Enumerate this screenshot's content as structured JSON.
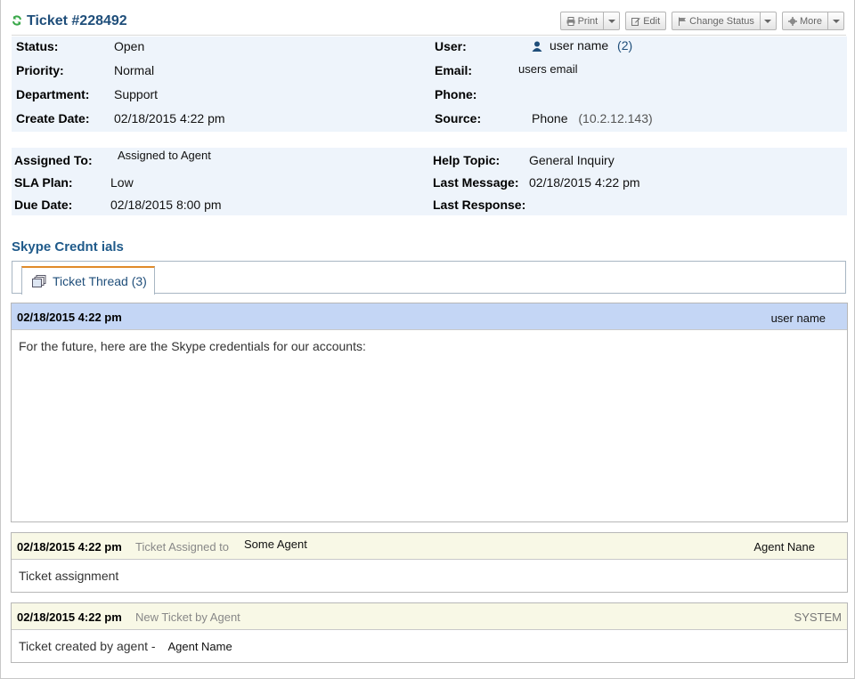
{
  "header": {
    "title": "Ticket #228492",
    "toolbar": {
      "print": "Print",
      "edit": "Edit",
      "change_status": "Change Status",
      "more": "More"
    }
  },
  "info1": {
    "status_label": "Status:",
    "status": "Open",
    "priority_label": "Priority:",
    "priority": "Normal",
    "department_label": "Department:",
    "department": "Support",
    "create_date_label": "Create Date:",
    "create_date": "02/18/2015 4:22 pm",
    "user_label": "User:",
    "user": "user name",
    "user_count": "(2)",
    "email_label": "Email:",
    "email": "users email",
    "phone_label": "Phone:",
    "phone": "",
    "source_label": "Source:",
    "source": "Phone",
    "source_ip": "(10.2.12.143)"
  },
  "info2": {
    "assigned_label": "Assigned To:",
    "assigned": "Assigned to Agent",
    "sla_label": "SLA Plan:",
    "sla": "Low",
    "due_label": "Due Date:",
    "due": "02/18/2015 8:00 pm",
    "help_label": "Help Topic:",
    "help": "General Inquiry",
    "last_msg_label": "Last Message:",
    "last_msg": "02/18/2015 4:22 pm",
    "last_resp_label": "Last Response:",
    "last_resp": ""
  },
  "section_title": "Skype Crednt ials",
  "tabs": [
    {
      "label": "Ticket Thread (3)"
    }
  ],
  "thread": [
    {
      "date": "02/18/2015 4:22 pm",
      "title": "",
      "who": "user name",
      "body": "For the future, here are the Skype credentials for our accounts:"
    },
    {
      "date": "02/18/2015 4:22 pm",
      "title": "Ticket Assigned to",
      "title_extra": "Some Agent",
      "who": "Agent Nane",
      "body": "Ticket assignment"
    },
    {
      "date": "02/18/2015 4:22 pm",
      "title": "New Ticket by Agent",
      "who": "SYSTEM",
      "body": "Ticket created by agent -",
      "body_extra": "Agent Name"
    }
  ],
  "colors": {
    "title": "#1f4e7a",
    "panel_bg": "#eef4fb",
    "message_header": "#c4d6f5",
    "note_header": "#f8f8e6",
    "tab_accent": "#e08a2a",
    "refresh_icon": "#3aa84a"
  },
  "icons": {
    "refresh": "refresh-icon",
    "print": "print-icon",
    "edit": "edit-icon",
    "change_status": "flag-icon",
    "more": "gear-icon",
    "user": "user-icon",
    "thread": "thread-icon"
  }
}
